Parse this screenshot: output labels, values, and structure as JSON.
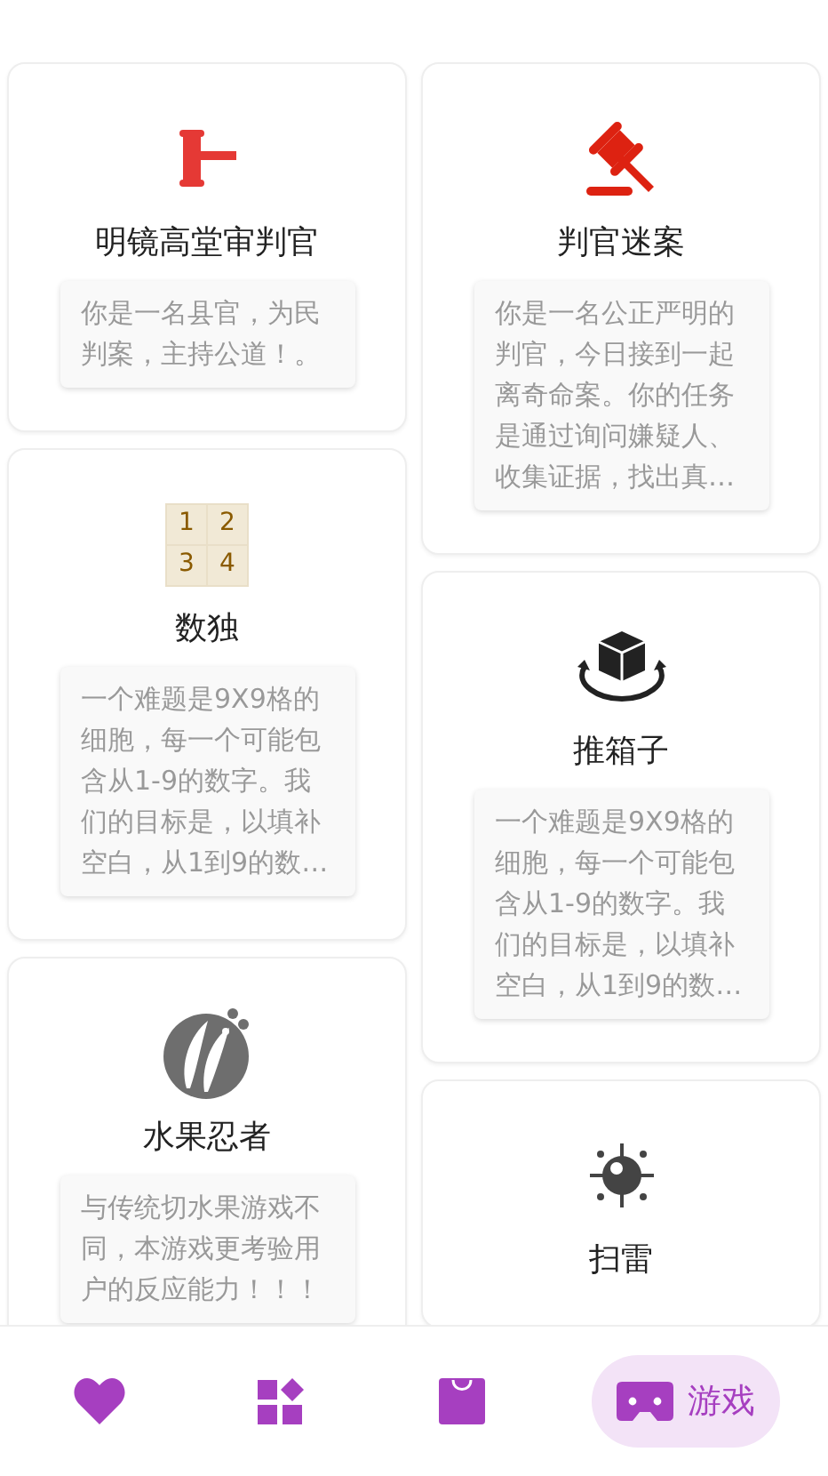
{
  "columns": [
    [
      {
        "icon": {
          "kind": "gavel-flat"
        },
        "title": "明镜高堂审判官",
        "description": "你是一名县官，为民判案，主持公道！。"
      },
      {
        "icon": {
          "kind": "grid",
          "digits": [
            "1",
            "2",
            "3",
            "4"
          ]
        },
        "title": "数独",
        "description": "一个难题是9X9格的细胞，每一个可能包含从1-9的数字。我们的目标是，以填补空白，从1到9的数…"
      },
      {
        "icon": {
          "kind": "fruit"
        },
        "title": "水果忍者",
        "description": "与传统切水果游戏不同，本游戏更考验用户的反应能力！！！"
      }
    ],
    [
      {
        "icon": {
          "kind": "gavel-tilted"
        },
        "title": "判官迷案",
        "description": "你是一名公正严明的判官，今日接到一起离奇命案。你的任务是通过询问嫌疑人、收集证据，找出真…"
      },
      {
        "icon": {
          "kind": "cube"
        },
        "title": "推箱子",
        "description": "一个难题是9X9格的细胞，每一个可能包含从1-9的数字。我们的目标是，以填补空白，从1到9的数…"
      },
      {
        "icon": {
          "kind": "mine"
        },
        "title": "扫雷"
      }
    ]
  ],
  "nav": [
    {
      "kind": "heart",
      "selected": false
    },
    {
      "kind": "widgets",
      "selected": false
    },
    {
      "kind": "bag",
      "selected": false
    },
    {
      "kind": "gamepad",
      "selected": true,
      "label": "游戏"
    }
  ]
}
